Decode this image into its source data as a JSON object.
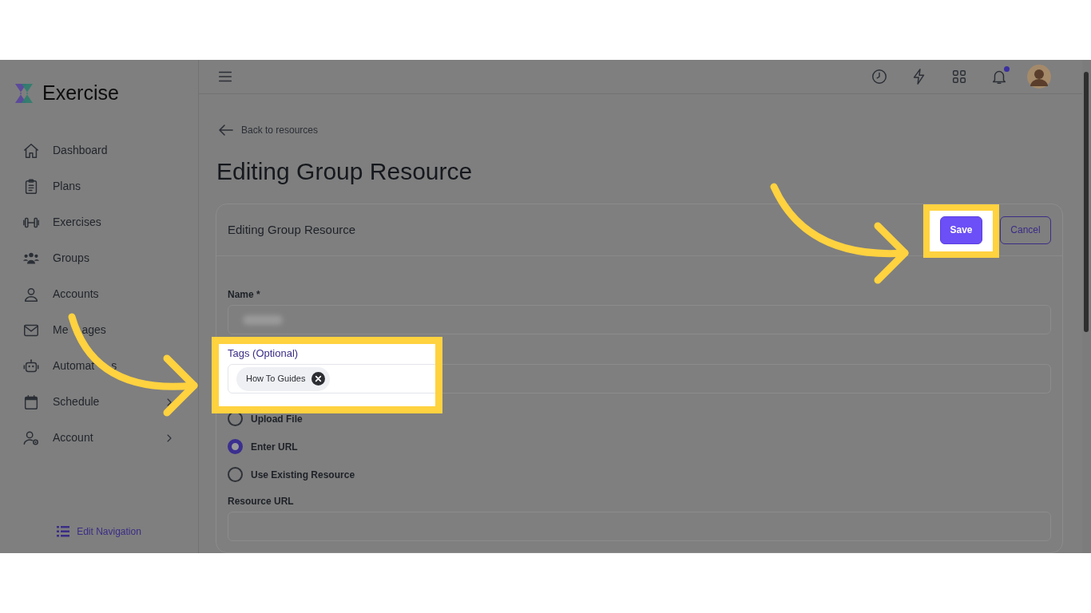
{
  "brand": {
    "name": "Exercise"
  },
  "sidebar": {
    "items": [
      {
        "label": "Dashboard",
        "kind": "home",
        "expandable": false
      },
      {
        "label": "Plans",
        "kind": "clipboard",
        "expandable": false
      },
      {
        "label": "Exercises",
        "kind": "dumbbell",
        "expandable": false
      },
      {
        "label": "Groups",
        "kind": "people",
        "expandable": false
      },
      {
        "label": "Accounts",
        "kind": "person",
        "expandable": false
      },
      {
        "label_parts": [
          "Me",
          "ages"
        ],
        "kind": "mail",
        "expandable": false
      },
      {
        "label_parts": [
          "Automat",
          "s"
        ],
        "kind": "robot",
        "expandable": false
      },
      {
        "label": "Schedule",
        "kind": "calendar",
        "expandable": true
      },
      {
        "label": "Account",
        "kind": "person-gear",
        "expandable": true
      }
    ],
    "footer": {
      "label": "Edit Navigation"
    }
  },
  "topbar": {
    "icons": [
      {
        "kind": "history"
      },
      {
        "kind": "bolt"
      },
      {
        "kind": "apps"
      },
      {
        "kind": "bell",
        "unread": true
      },
      {
        "kind": "avatar"
      }
    ]
  },
  "back_link": "Back to resources",
  "page_title": "Editing Group Resource",
  "card": {
    "title": "Editing Group Resource",
    "buttons": [
      {
        "label": "Save",
        "kind": "primary",
        "highlighted": true
      },
      {
        "label": "Cancel",
        "kind": "outline",
        "highlighted": false
      }
    ],
    "fields": [
      {
        "kind": "text",
        "label": "Name *",
        "redacted": true
      },
      {
        "kind": "tags",
        "label": "Tags (Optional)",
        "tags": [
          "How To Guides"
        ],
        "highlighted": true
      },
      {
        "kind": "radio",
        "options": [
          {
            "label": "Upload File",
            "selected": false
          },
          {
            "label": "Enter URL",
            "selected": true
          },
          {
            "label": "Use Existing Resource",
            "selected": false
          }
        ]
      },
      {
        "kind": "text",
        "label": "Resource URL"
      }
    ]
  }
}
